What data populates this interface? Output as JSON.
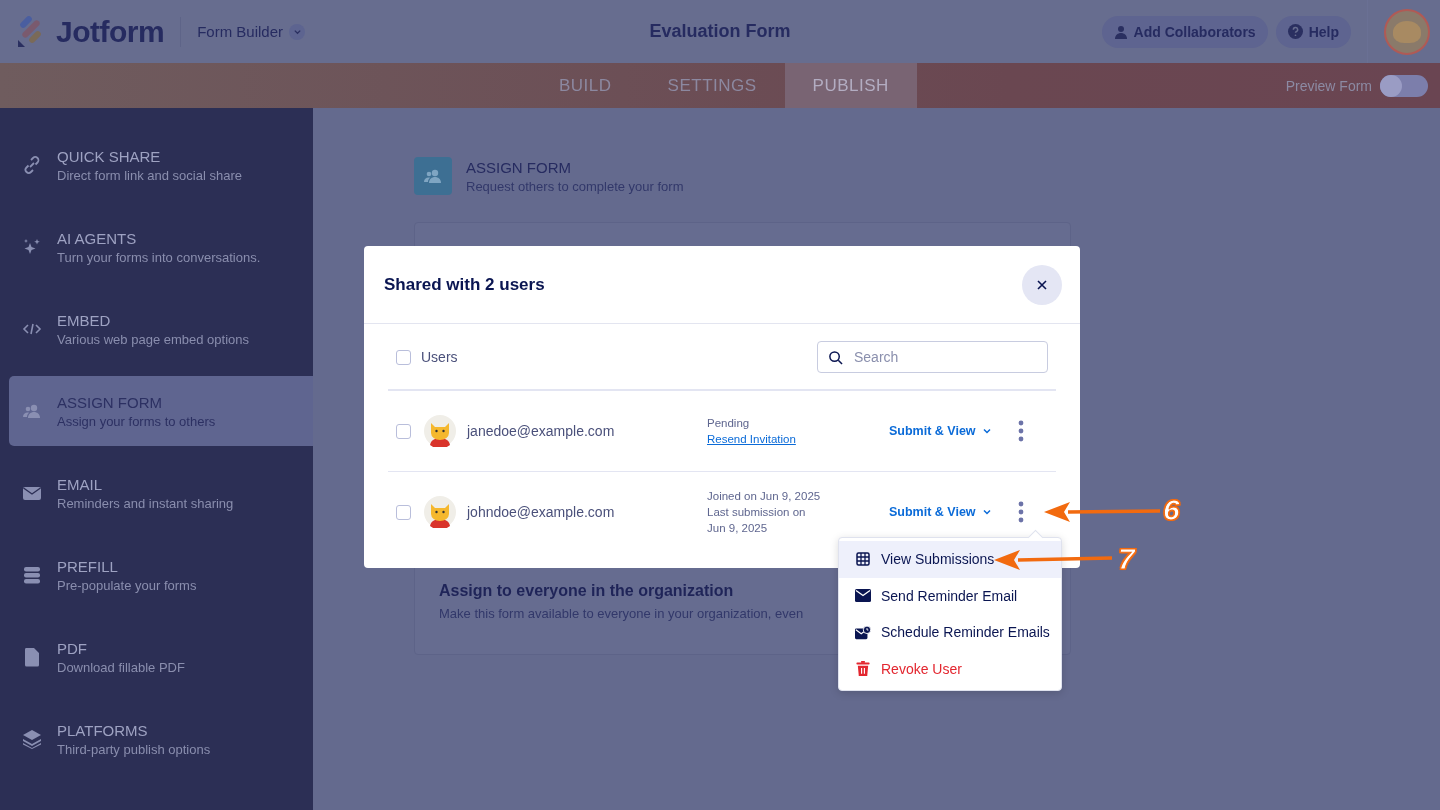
{
  "header": {
    "logo": "Jotform",
    "builder_menu": "Form Builder",
    "title": "Evaluation Form",
    "buttons": [
      {
        "label": "Add Collaborators"
      },
      {
        "label": "Help"
      }
    ]
  },
  "tabs": [
    {
      "label": "BUILD",
      "selected": false
    },
    {
      "label": "SETTINGS",
      "selected": false
    },
    {
      "label": "PUBLISH",
      "selected": true
    }
  ],
  "preview": {
    "label": "Preview Form",
    "on": false
  },
  "sidebar": {
    "items": [
      {
        "title": "QUICK SHARE",
        "subtitle": "Direct form link and social share",
        "selected": false
      },
      {
        "title": "AI AGENTS",
        "subtitle": "Turn your forms into conversations.",
        "selected": false
      },
      {
        "title": "EMBED",
        "subtitle": "Various web page embed options",
        "selected": false
      },
      {
        "title": "ASSIGN FORM",
        "subtitle": "Assign your forms to others",
        "selected": true
      },
      {
        "title": "EMAIL",
        "subtitle": "Reminders and instant sharing",
        "selected": false
      },
      {
        "title": "PREFILL",
        "subtitle": "Pre-populate your forms",
        "selected": false
      },
      {
        "title": "PDF",
        "subtitle": "Download fillable PDF",
        "selected": false
      },
      {
        "title": "PLATFORMS",
        "subtitle": "Third-party publish options",
        "selected": false
      }
    ]
  },
  "section": {
    "title": "ASSIGN FORM",
    "subtitle": "Request others to complete your form",
    "card_title": "Assign to everyone in the organization",
    "card_text": "Make this form available to everyone in your organization, even"
  },
  "modal": {
    "title": "Shared with 2 users",
    "select_all": {
      "label": "Users",
      "checked": false
    },
    "search": {
      "placeholder": "Search"
    },
    "users": [
      {
        "email": "janedoe@example.com",
        "checked": false,
        "status": [
          "Pending"
        ],
        "link": "Resend Invitation",
        "permission": "Submit & View"
      },
      {
        "email": "johndoe@example.com",
        "checked": false,
        "status": [
          "Joined on Jun 9, 2025",
          "Last submission on",
          "Jun 9, 2025"
        ],
        "permission": "Submit & View"
      }
    ]
  },
  "menu": {
    "items": [
      {
        "label": "View Submissions",
        "selected": true,
        "kind": "normal"
      },
      {
        "label": "Send Reminder Email",
        "selected": false,
        "kind": "normal"
      },
      {
        "label": "Schedule Reminder Emails",
        "selected": false,
        "kind": "normal"
      },
      {
        "label": "Revoke User",
        "selected": false,
        "kind": "danger"
      }
    ]
  },
  "annotations": [
    {
      "label": "6"
    },
    {
      "label": "7"
    }
  ]
}
